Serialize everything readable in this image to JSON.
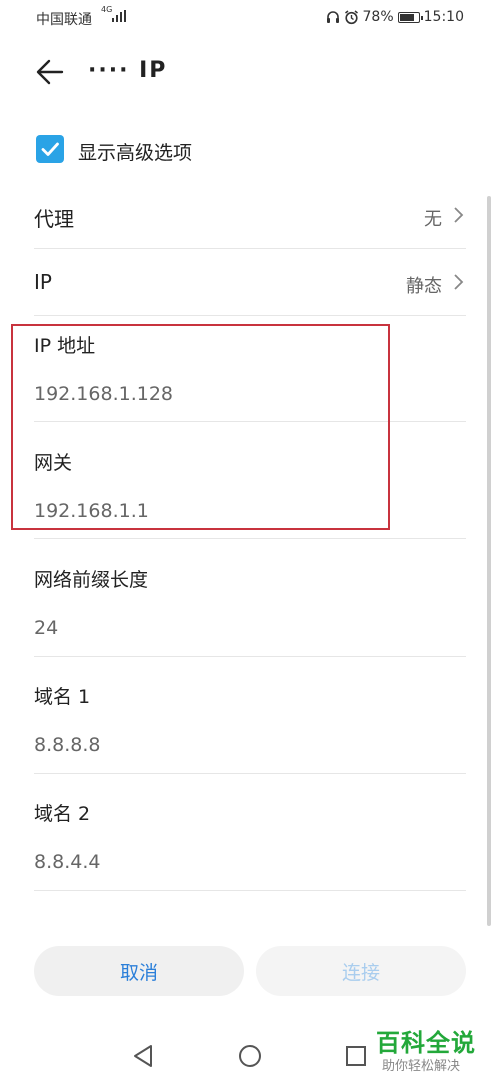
{
  "status_bar": {
    "carrier": "中国联通",
    "network": "4G",
    "battery": "78%",
    "time": "15:10"
  },
  "header": {
    "title": "···· IP"
  },
  "advanced": {
    "label": "显示高级选项",
    "checked": true
  },
  "proxy": {
    "label": "代理",
    "value": "无"
  },
  "ip_mode": {
    "label": "IP",
    "value": "静态"
  },
  "fields": {
    "ip_address": {
      "label": "IP 地址",
      "value": "192.168.1.128"
    },
    "gateway": {
      "label": "网关",
      "value": "192.168.1.1"
    },
    "prefix_length": {
      "label": "网络前缀长度",
      "value": "24"
    },
    "dns1": {
      "label": "域名 1",
      "value": "8.8.8.8"
    },
    "dns2": {
      "label": "域名 2",
      "value": "8.8.4.4"
    }
  },
  "actions": {
    "cancel": "取消",
    "connect": "连接"
  },
  "watermark": {
    "main": "百科全说",
    "sub": "助你轻松解决"
  },
  "colors": {
    "accent": "#2aa3e6",
    "highlight_box": "#c8333e",
    "button_text": "#2b7fd9",
    "watermark": "#23a83a"
  }
}
